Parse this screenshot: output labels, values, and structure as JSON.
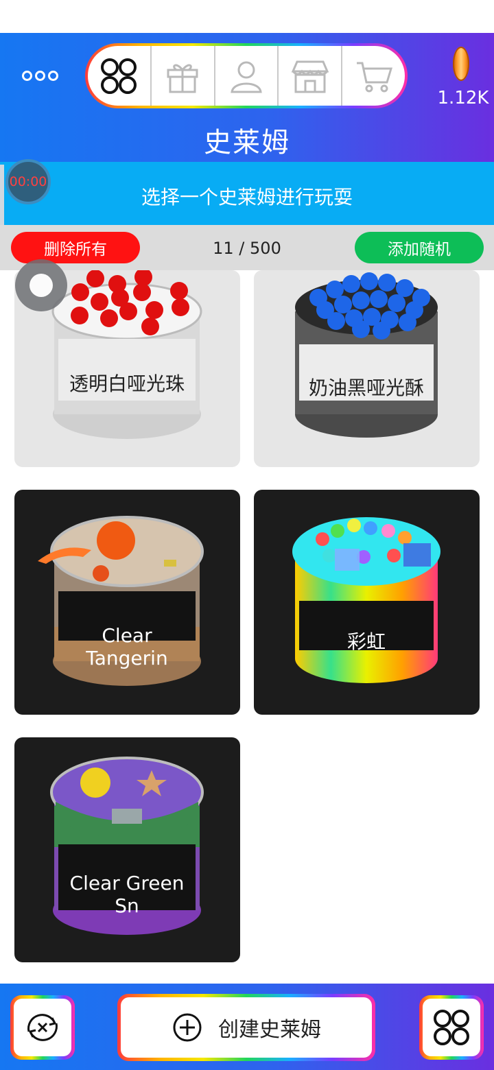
{
  "header": {
    "title": "史莱姆",
    "coins": "1.12K",
    "tabs": [
      {
        "icon": "grid-icon",
        "active": true
      },
      {
        "icon": "gift-icon"
      },
      {
        "icon": "user-icon"
      },
      {
        "icon": "shop-icon"
      },
      {
        "icon": "cart-icon"
      }
    ]
  },
  "timer": "00:00",
  "subheader": "选择一个史莱姆进行玩耍",
  "actions": {
    "delete_all": "删除所有",
    "count": "11 / 500",
    "add_random": "添加随机"
  },
  "slimes": [
    {
      "label": "透明白哑光珠",
      "theme": "light",
      "icon": "slime-jar-white-red-beads"
    },
    {
      "label": "奶油黑哑光酥",
      "theme": "light",
      "icon": "slime-jar-black-blue-beads"
    },
    {
      "label": "Clear Tangerin",
      "theme": "dark",
      "icon": "slime-jar-tangerine"
    },
    {
      "label": "彩虹",
      "theme": "dark",
      "icon": "slime-jar-rainbow"
    },
    {
      "label": "Clear Green Sn",
      "theme": "dark",
      "icon": "slime-jar-green-purple"
    }
  ],
  "bottom": {
    "create_label": "创建史莱姆",
    "left_icon": "swap-icon",
    "right_icon": "grid-icon"
  },
  "colors": {
    "header_start": "#1677f2",
    "header_end": "#6a2fe0",
    "subheader": "#08acf4",
    "delete_button": "#ff1212",
    "add_button": "#0dbe57",
    "timer_text": "#ff4040"
  }
}
